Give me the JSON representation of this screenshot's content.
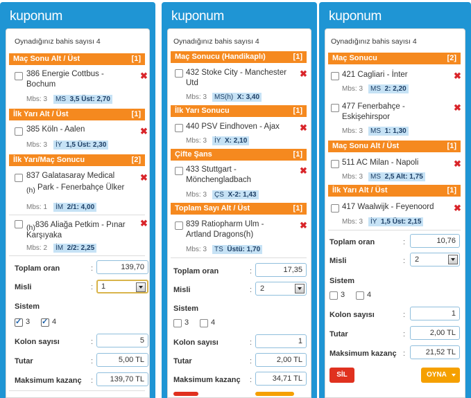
{
  "p1": {
    "title": "kuponum",
    "count": "Oynadığınız bahis sayısı 4",
    "sections": [
      {
        "name": "Maç Sonu Alt / Üst",
        "count": "[1]"
      },
      {
        "name": "İlk Yarı Alt / Üst",
        "count": "[1]"
      },
      {
        "name": "İlk Yarı/Maç Sonucu",
        "count": "[2]"
      }
    ],
    "bets": [
      {
        "code": "386",
        "line1": "Energie Cottbus -",
        "line2": "Bochum",
        "prefix": "",
        "mbs": "Mbs: 3",
        "mkt": "MS",
        "pick": "3,5 Üst: 2,70"
      },
      {
        "code": "385",
        "line1": "Köln - Aalen",
        "line2": "",
        "prefix": "",
        "mbs": "Mbs: 3",
        "mkt": "İY",
        "pick": "1,5 Üst: 2,30"
      },
      {
        "code": "837",
        "line1": "Galatasaray Medical",
        "line2": "Park - Fenerbahçe Ülker",
        "prefix": "(h)",
        "mbs": "Mbs: 1",
        "mkt": "İM",
        "pick": "2/1: 4,00"
      },
      {
        "code": "836",
        "line1": "Aliağa Petkim - Pınar",
        "line2": "Karşıyaka",
        "prefix": "(h)",
        "mbs": "Mbs: 2",
        "mkt": "İM",
        "pick": "2/2: 2,25"
      }
    ],
    "total_label": "Toplam oran",
    "total_value": "139,70",
    "misli_label": "Misli",
    "misli_value": "1",
    "sistem_label": "Sistem",
    "sistem_opts": [
      "3",
      "4"
    ],
    "kolon_label": "Kolon sayısı",
    "kolon_value": "5",
    "tutar_label": "Tutar",
    "tutar_value": "5,00 TL",
    "max_label": "Maksimum kazanç",
    "max_value": "139,70 TL"
  },
  "p2": {
    "title": "kuponum",
    "count": "Oynadığınız bahis sayısı 4",
    "sections": [
      {
        "name": "Maç Sonucu (Handikaplı)",
        "count": "[1]"
      },
      {
        "name": "İlk Yarı Sonucu",
        "count": "[1]"
      },
      {
        "name": "Çifte Şans",
        "count": "[1]"
      },
      {
        "name": "Toplam Sayı Alt / Üst",
        "count": "[1]"
      }
    ],
    "bets": [
      {
        "code": "432",
        "line1": "Stoke City - Manchester",
        "line2": "Utd",
        "mbs": "Mbs: 3",
        "mkt": "MS(h)",
        "pick": "X: 3,40"
      },
      {
        "code": "440",
        "line1": "PSV Eindhoven - Ajax",
        "line2": "",
        "mbs": "Mbs: 3",
        "mkt": "İY",
        "pick": "X: 2,10"
      },
      {
        "code": "433",
        "line1": "Stuttgart -",
        "line2": "Mönchengladbach",
        "mbs": "Mbs: 3",
        "mkt": "ÇS",
        "pick": "X-2: 1,43"
      },
      {
        "code": "839",
        "line1": "Ratiopharm Ulm -",
        "line2": "Artland Dragons(h)",
        "mbs": "Mbs: 3",
        "mkt": "TS",
        "pick": "Üstü: 1,70"
      }
    ],
    "total_label": "Toplam oran",
    "total_value": "17,35",
    "misli_label": "Misli",
    "misli_value": "2",
    "sistem_label": "Sistem",
    "sistem_opts": [
      "3",
      "4"
    ],
    "kolon_label": "Kolon sayısı",
    "kolon_value": "1",
    "tutar_label": "Tutar",
    "tutar_value": "2,00 TL",
    "max_label": "Maksimum kazanç",
    "max_value": "34,71 TL"
  },
  "p3": {
    "title": "kuponum",
    "count": "Oynadığınız bahis sayısı 4",
    "sections": [
      {
        "name": "Maç Sonucu",
        "count": "[2]"
      },
      {
        "name": "Maç Sonu Alt / Üst",
        "count": "[1]"
      },
      {
        "name": "İlk Yarı Alt / Üst",
        "count": "[1]"
      }
    ],
    "bets": [
      {
        "code": "421",
        "line1": "Cagliari - İnter",
        "line2": "",
        "mbs": "Mbs: 3",
        "mkt": "MS",
        "pick": "2: 2,20"
      },
      {
        "code": "477",
        "line1": "Fenerbahçe -",
        "line2": "Eskişehirspor",
        "mbs": "Mbs: 3",
        "mkt": "MS",
        "pick": "1: 1,30"
      },
      {
        "code": "511",
        "line1": "AC Milan - Napoli",
        "line2": "",
        "mbs": "Mbs: 3",
        "mkt": "MS",
        "pick": "2,5 Alt: 1,75"
      },
      {
        "code": "417",
        "line1": "Waalwijk - Feyenoord",
        "line2": "",
        "mbs": "Mbs: 3",
        "mkt": "İY",
        "pick": "1,5 Üst: 2,15"
      }
    ],
    "total_label": "Toplam oran",
    "total_value": "10,76",
    "misli_label": "Misli",
    "misli_value": "2",
    "sistem_label": "Sistem",
    "sistem_opts": [
      "3",
      "4"
    ],
    "kolon_label": "Kolon sayısı",
    "kolon_value": "1",
    "tutar_label": "Tutar",
    "tutar_value": "2,00 TL",
    "max_label": "Maksimum kazanç",
    "max_value": "21,52 TL",
    "sil_label": "SİL",
    "oyna_label": "OYNA"
  },
  "icons": {
    "remove": "close-icon",
    "dropdown": "chevron-down-icon",
    "checkbox": "checkbox-icon"
  },
  "colors": {
    "header_blue": "#1f95d4",
    "section_orange": "#f5891f",
    "remove_red": "#d9252a",
    "sil_red": "#e0311f",
    "oyna_orange": "#f5a000"
  }
}
